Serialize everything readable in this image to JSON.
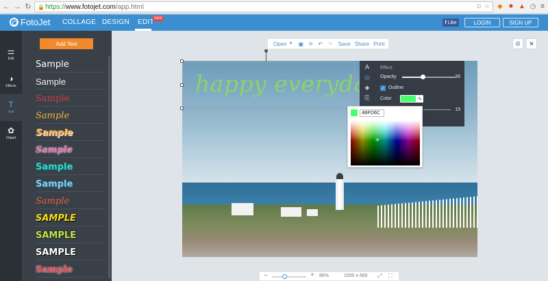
{
  "browser": {
    "url_scheme": "https://",
    "url_host": "www.fotojet.com",
    "url_path": "/app.html"
  },
  "app": {
    "logo": "FotoJet",
    "nav": [
      "COLLAGE",
      "DESIGN",
      "EDIT"
    ],
    "new_badge": "NEW",
    "fb_like": "Like",
    "login": "LOGIN",
    "signup": "SIGN UP",
    "accent": "#3b8fd1"
  },
  "rail": {
    "items": [
      {
        "label": "Edit",
        "icon": "sliders-icon"
      },
      {
        "label": "Effects",
        "icon": "half-circle-icon"
      },
      {
        "label": "Text",
        "icon": "text-t-icon"
      },
      {
        "label": "Clipart",
        "icon": "flower-icon"
      }
    ]
  },
  "panel": {
    "add_text": "Add Text",
    "samples": [
      {
        "text": "Sample",
        "color": "#ffffff"
      },
      {
        "text": "Sample",
        "color": "#ffffff"
      },
      {
        "text": "Sample",
        "color": "#cc3c46"
      },
      {
        "text": "Sample",
        "color": "#f2b33a"
      },
      {
        "text": "Sample",
        "color": "#f0a23a"
      },
      {
        "text": "Sample",
        "color": "#e86fb6"
      },
      {
        "text": "Sample",
        "color": "#36d6d0"
      },
      {
        "text": "Sample",
        "color": "#7fd2f2"
      },
      {
        "text": "Sample",
        "color": "#e8623a"
      },
      {
        "text": "SAMPLE",
        "color": "#f5e01a"
      },
      {
        "text": "SAMPLE",
        "color": "#bfe84a"
      },
      {
        "text": "SAMPLE",
        "color": "#ffffff"
      },
      {
        "text": "Sample",
        "color": "#e8424a"
      }
    ]
  },
  "toolbar": {
    "open": "Open",
    "save": "Save",
    "share": "Share",
    "print": "Print"
  },
  "canvas": {
    "text": "happy everyday",
    "text_color": "#8bd36c"
  },
  "effect": {
    "title": "Effect",
    "opacity_label": "Opacity",
    "opacity_value": "39",
    "opacity_fraction": 0.39,
    "outline_label": "Outline",
    "color_label": "Color",
    "color_hex": "4BFD6C",
    "second_value": "19"
  },
  "zoom": {
    "percent": "86%",
    "size": "1000 x 666",
    "level_fraction": 0.35
  }
}
